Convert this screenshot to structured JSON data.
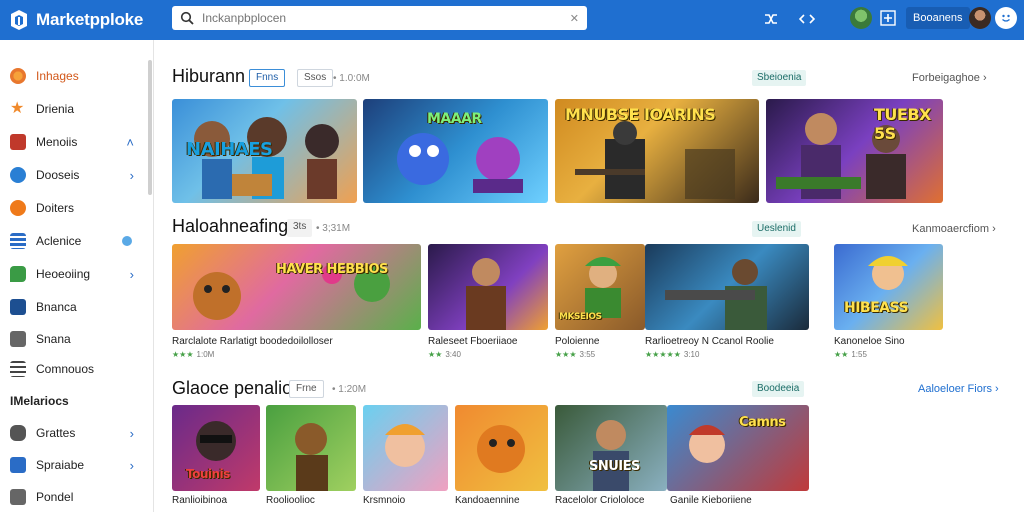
{
  "app": {
    "brand": "Marketpploke",
    "search_placeholder": "Inckanpbplocen",
    "search_clear": "✕",
    "account_label": "Booanens"
  },
  "sidebar": {
    "items": [
      {
        "label": "Inhages",
        "active": true,
        "color": "#e8772e"
      },
      {
        "label": "Drienia",
        "color": "#f08a2c"
      },
      {
        "label": "Menoiis",
        "color": "#c0392b",
        "chev": "˄"
      },
      {
        "label": "Dooseis",
        "color": "#2a7fd4",
        "chev": "›"
      },
      {
        "label": "Doiters",
        "color": "#ef7a1a"
      },
      {
        "label": "Aclenice",
        "color": "#2a6cc6",
        "dot": true
      },
      {
        "label": "Heoeoiing",
        "color": "#3a9b45",
        "chev": "›"
      },
      {
        "label": "Bnanca",
        "color": "#1d4f91"
      },
      {
        "label": "Snana",
        "color": "#666666"
      },
      {
        "label": "Comnouos",
        "color": "#444444"
      }
    ],
    "group_title": "IMelariocs",
    "group_items": [
      {
        "label": "Grattes",
        "color": "#555555",
        "chev": "›"
      },
      {
        "label": "Spraiabe",
        "color": "#2a6cc6",
        "chev": "›"
      },
      {
        "label": "Pondel",
        "color": "#666666"
      }
    ]
  },
  "sections": [
    {
      "title": "Hiburann",
      "chip1": "Fnns",
      "chip2": "Ssos",
      "meta": "• 1.0:0M",
      "tag": "Sbeioenia",
      "see_all": "Forbeigaghoe ›",
      "cards": [
        {
          "art": "NAIHAES",
          "stars": "",
          "title": ""
        },
        {
          "art": "MAAAR",
          "stars": "",
          "title": ""
        },
        {
          "art": "MNUBSE IOARINS",
          "stars": "",
          "title": ""
        },
        {
          "art": "TUEBX 5S",
          "stars": "",
          "title": ""
        }
      ]
    },
    {
      "title": "Haloahneafinga",
      "chip1": "3ts",
      "meta": "• 3;31M",
      "tag": "Ueslenid",
      "see_all": "Kanmoaercfiom ›",
      "cards": [
        {
          "art": "HAVER HEBBIOS",
          "title": "Rarclalote Rarlatigt boodedoilolloser",
          "stars": "★★★",
          "reviews": "1:0M"
        },
        {
          "art": "",
          "title": "Raleseet Fboeriiaoe",
          "stars": "★★",
          "reviews": "3:40"
        },
        {
          "art": "MKSEIOS",
          "title": "Poloienne",
          "stars": "★★★",
          "reviews": "3:55"
        },
        {
          "art": "",
          "title": "Rarlioetreoy N Ccanol Roolie",
          "stars": "★★★★★",
          "reviews": "3:10"
        },
        {
          "art": "HIBEASS",
          "title": "Kanoneloe Sino",
          "stars": "★★",
          "reviews": "1:55"
        }
      ]
    },
    {
      "title": "Glaoce penaliona",
      "chip1": "Frne",
      "meta": "• 1:20M",
      "tag": "Boodeeia",
      "see_all": "Aaloeloer Fiors ›",
      "cards": [
        {
          "art": "Touinis",
          "title": "Ranlioibinoa"
        },
        {
          "art": "",
          "title": "Roolioolioc"
        },
        {
          "art": "",
          "title": "Krsmnoio"
        },
        {
          "art": "",
          "title": "Kandoaennine"
        },
        {
          "art": "SNUIES",
          "title": "Racelolor Criololoce"
        },
        {
          "art": "Camns",
          "title": "Ganile Kieboriiene"
        }
      ]
    }
  ]
}
